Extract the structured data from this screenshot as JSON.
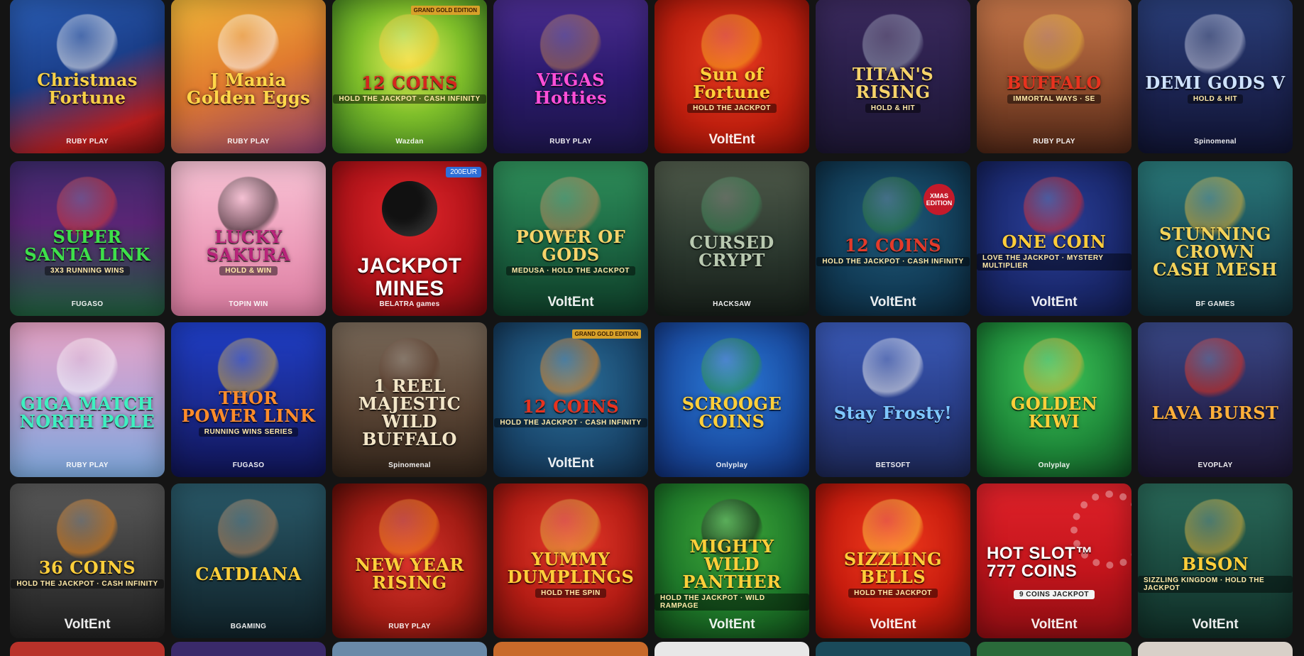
{
  "games": [
    {
      "title": "Christmas Fortune",
      "provider": "RUBY PLAY",
      "bg": "linear-gradient(160deg,#2b5fb8 0%,#1b3f8a 45%,#b51d1d 80%,#6b0d0d 100%)",
      "art": "#f2f2f2",
      "color": "#f7d046"
    },
    {
      "title": "J Mania Golden Eggs",
      "provider": "RUBY PLAY",
      "bg": "linear-gradient(160deg,#f3b93a 0%,#e07a2f 50%,#8c3d6b 100%)",
      "art": "#ffffff",
      "color": "#ffd84a"
    },
    {
      "title": "12 COINS",
      "sub": "HOLD THE JACKPOT · CASH INFINITY",
      "provider": "Wazdan",
      "edition": "GRAND GOLD EDITION",
      "bg": "radial-gradient(circle at 50% 40%,#e9f05a 0%,#7fbf2a 45%,#2d6d1e 100%)",
      "art": "#ffcc33",
      "color": "#d4261f"
    },
    {
      "title": "VEGAS Hotties",
      "provider": "RUBY PLAY",
      "bg": "linear-gradient(180deg,#4a2d8f 0%,#2c1a6e 50%,#1b1446 100%)",
      "art": "#b77a52",
      "color": "#ff4fd8"
    },
    {
      "title": "Sun of Fortune",
      "sub": "HOLD THE JACKPOT",
      "provider": "VoltEnt",
      "providerBig": true,
      "bg": "radial-gradient(circle at 50% 40%,#e63a1f 0%,#c0200f 55%,#7e0d05 100%)",
      "art": "#f7a81c",
      "color": "#ffcf3a"
    },
    {
      "title": "TITAN'S RISING",
      "sub": "HOLD & HIT",
      "bg": "linear-gradient(180deg,#3b2a5e 0%,#2a1f4a 50%,#1b1530 100%)",
      "art": "#9aa0b8",
      "color": "#f6d36a"
    },
    {
      "title": "BUFFALO",
      "sub": "IMMORTAL WAYS · SE",
      "provider": "RUBY PLAY",
      "bg": "linear-gradient(180deg,#c7774a 0%,#8a4a2b 60%,#4a2415 100%)",
      "art": "#e4b43a",
      "color": "#e8321e"
    },
    {
      "title": "DEMI GODS V",
      "sub": "HOLD & HIT",
      "provider": "Spinomenal",
      "bg": "linear-gradient(180deg,#2a3f7a 0%,#1b2350 60%,#0f1330 100%)",
      "art": "#c7cbe0",
      "color": "#cfe3ff"
    },
    {
      "title": "SUPER SANTA LINK",
      "sub": "3X3 RUNNING WINS",
      "provider": "FUGASO",
      "bg": "linear-gradient(180deg,#3d2a6b 0%,#5a2575 40%,#1e5a3a 100%)",
      "art": "#d63a3a",
      "color": "#3ee04a"
    },
    {
      "title": "LUCKY SAKURA",
      "sub": "HOLD & WIN",
      "provider": "TOPIN WIN",
      "bg": "linear-gradient(180deg,#f8c3d5 0%,#ec9ab8 60%,#d77a9e 100%)",
      "art": "#1c1c1c",
      "color": "#b8247a"
    },
    {
      "title": "JACKPOT MINES",
      "provider": "BELATRA games",
      "badge": "200EUR",
      "bomb": true,
      "bg": "radial-gradient(circle at 50% 35%,#e0262b 0%,#b21319 55%,#6b0a0d 100%)",
      "color": "#ffffff"
    },
    {
      "title": "POWER OF GODS",
      "sub": "MEDUSA · HOLD THE JACKPOT",
      "provider": "VoltEnt",
      "providerBig": true,
      "bg": "linear-gradient(180deg,#2f8f5a 0%,#1d6a45 50%,#0e3a26 100%)",
      "art": "#c48a5c",
      "color": "#f6d36a"
    },
    {
      "title": "CURSED CRYPT",
      "provider": "HACKSAW",
      "bg": "linear-gradient(180deg,#4f5a4a 0%,#2d3a30 55%,#151c17 100%)",
      "art": "#3f8a5a",
      "color": "#b9c9b0"
    },
    {
      "title": "12 COINS",
      "sub": "HOLD THE JACKPOT · CASH INFINITY",
      "provider": "VoltEnt",
      "providerBig": true,
      "xmas": "XMAS EDITION",
      "bg": "radial-gradient(circle at 50% 40%,#1f5a7a 0%,#123d58 55%,#0a2233 100%)",
      "art": "#2e7d3a",
      "color": "#e33a2a"
    },
    {
      "title": "ONE COIN",
      "sub": "LOVE THE JACKPOT · MYSTERY MULTIPLIER",
      "provider": "VoltEnt",
      "providerBig": true,
      "bg": "radial-gradient(circle at 50% 40%,#2a3f9a 0%,#1b2a70 55%,#0f1845 100%)",
      "art": "#e02a2a",
      "color": "#ffcc3a"
    },
    {
      "title": "STUNNING CROWN CASH MESH",
      "provider": "BF GAMES",
      "bg": "linear-gradient(180deg,#2a7a7a 0%,#1b4f5a 55%,#0f2a33 100%)",
      "art": "#e2b43a",
      "color": "#f2d25a"
    },
    {
      "title": "GIGA MATCH NORTH POLE",
      "provider": "RUBY PLAY",
      "bg": "linear-gradient(180deg,#e7a3c4 0%,#b8a5d8 50%,#7aa5d8 100%)",
      "art": "#ffffff",
      "color": "#3ef0c0"
    },
    {
      "title": "THOR POWER LINK",
      "sub": "RUNNING WINS SERIES",
      "provider": "FUGASO",
      "bg": "linear-gradient(180deg,#1f3fc8 0%,#1b2a8f 55%,#0f1350 100%)",
      "art": "#e2b43a",
      "color": "#ff8c2a"
    },
    {
      "title": "1 REEL MAJESTIC WILD BUFFALO",
      "provider": "Spinomenal",
      "bg": "linear-gradient(180deg,#7a6a5a 0%,#5a4535 55%,#2f2218 100%)",
      "art": "#5a3a2a",
      "color": "#f3e6c8"
    },
    {
      "title": "12 COINS",
      "sub": "HOLD THE JACKPOT · CASH INFINITY",
      "provider": "VoltEnt",
      "providerBig": true,
      "edition": "GRAND GOLD EDITION",
      "bg": "radial-gradient(circle at 50% 40%,#2a6f9a 0%,#1b4a70 55%,#0f2a45 100%)",
      "art": "#f28a1c",
      "color": "#e8321e"
    },
    {
      "title": "SCROOGE COINS",
      "provider": "Onlyplay",
      "bg": "radial-gradient(circle at 50% 40%,#2a7ad8 0%,#1b4fa5 55%,#0f2a6b 100%)",
      "art": "#2e9a3a",
      "color": "#ffcf3a"
    },
    {
      "title": "Stay Frosty!",
      "provider": "BETSOFT",
      "bg": "linear-gradient(180deg,#3a5ab8 0%,#2a3f8a 55%,#1b2550 100%)",
      "art": "#f2f2f2",
      "color": "#7fc8ff"
    },
    {
      "title": "GOLDEN KIWI",
      "provider": "Onlyplay",
      "bg": "radial-gradient(circle at 50% 35%,#3ec85a 0%,#1f8a3a 55%,#0e4a1f 100%)",
      "art": "#e2b43a",
      "color": "#ffcf3a"
    },
    {
      "title": "LAVA BURST",
      "provider": "EVOPLAY",
      "bg": "linear-gradient(180deg,#3a4a8a 0%,#2a2a5a 50%,#1b1530 100%)",
      "art": "#e8321e",
      "color": "#ffb03a"
    },
    {
      "title": "36 COINS",
      "sub": "HOLD THE JACKPOT · CASH INFINITY",
      "provider": "VoltEnt",
      "providerBig": true,
      "bg": "linear-gradient(180deg,#5a5a5a 0%,#3a3a3a 55%,#1f1f1f 100%)",
      "art": "#f28a1c",
      "color": "#ffcf3a"
    },
    {
      "title": "CATDIANA",
      "provider": "BGAMING",
      "bg": "linear-gradient(180deg,#2a5a6a 0%,#1b3a45 55%,#0f1f25 100%)",
      "art": "#c48a5c",
      "color": "#ffcf3a"
    },
    {
      "title": "NEW YEAR RISING",
      "provider": "RUBY PLAY",
      "bg": "radial-gradient(circle at 50% 50%,#d8322a 0%,#a51d15 55%,#5a0d08 100%)",
      "art": "#f28a1c",
      "color": "#ffcf3a"
    },
    {
      "title": "YUMMY DUMPLINGS",
      "sub": "HOLD THE SPIN",
      "bg": "radial-gradient(circle at 50% 40%,#e83a2a 0%,#b51d15 55%,#6b0d08 100%)",
      "art": "#e2b43a",
      "color": "#ffcf3a"
    },
    {
      "title": "MIGHTY WILD PANTHER",
      "sub": "HOLD THE JACKPOT · WILD RAMPAGE",
      "provider": "VoltEnt",
      "providerBig": true,
      "bg": "radial-gradient(circle at 50% 35%,#3ea83a 0%,#1f7a2a 55%,#0e4015 100%)",
      "art": "#1c1c1c",
      "color": "#ffcf3a"
    },
    {
      "title": "SIZZLING BELLS",
      "sub": "HOLD THE JACKPOT",
      "provider": "VoltEnt",
      "providerBig": true,
      "bg": "radial-gradient(circle at 50% 40%,#f23a1c 0%,#c81d0f 55%,#7a0d05 100%)",
      "art": "#ffcf3a",
      "color": "#ffcf3a"
    },
    {
      "title": "HOT SLOT™ 777 COINS",
      "sub": "9 COINS JACKPOT",
      "provider": "VoltEnt",
      "providerBig": true,
      "hotslot": true,
      "bg": "linear-gradient(180deg,#e0222a 0%,#c4151c 55%,#8a0d12 100%)",
      "color": "#ffffff"
    },
    {
      "title": "BISON",
      "sub": "SIZZLING KINGDOM · HOLD THE JACKPOT",
      "provider": "VoltEnt",
      "providerBig": true,
      "bg": "linear-gradient(180deg,#2a6a5a 0%,#1b4a3f 55%,#0f2a23 100%)",
      "art": "#e2b43a",
      "color": "#ffcf3a"
    }
  ],
  "partial_row": [
    "#b8322a",
    "#3a2a6a",
    "#6a8aa8",
    "#c86a2a",
    "#e8e8e8",
    "#1a4a5a",
    "#2a6a3a",
    "#d8d0c8"
  ]
}
